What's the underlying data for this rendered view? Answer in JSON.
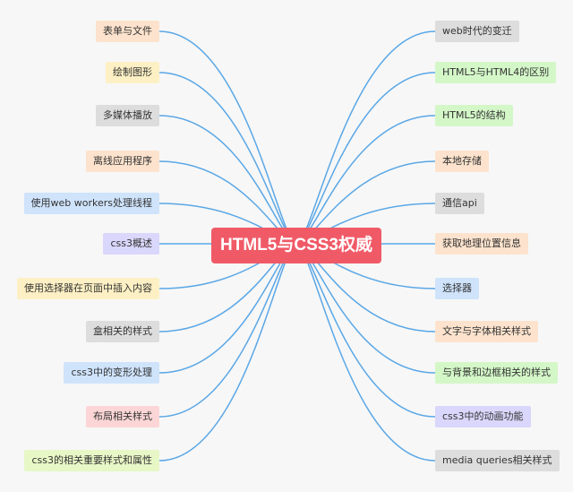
{
  "root": {
    "label": "HTML5与CSS3权威"
  },
  "colors": {
    "line": "#5aa7e6",
    "root_bg": "#f05a67",
    "blue": "#cfe3fb",
    "orange": "#fde3cd",
    "yellow": "#fdf0c4",
    "gray": "#dddddd",
    "purple": "#d9d7fb",
    "red": "#fcd6d6",
    "green": "#d4f7c8",
    "lime": "#e8f7c6"
  },
  "left": [
    {
      "label": "表单与文件",
      "color": "orange"
    },
    {
      "label": "绘制图形",
      "color": "yellow"
    },
    {
      "label": "多媒体播放",
      "color": "gray"
    },
    {
      "label": "离线应用程序",
      "color": "orange"
    },
    {
      "label": "使用web workers处理线程",
      "color": "blue"
    },
    {
      "label": "css3概述",
      "color": "purple"
    },
    {
      "label": "使用选择器在页面中插入内容",
      "color": "yellow"
    },
    {
      "label": "盒相关的样式",
      "color": "gray"
    },
    {
      "label": "css3中的变形处理",
      "color": "blue"
    },
    {
      "label": "布局相关样式",
      "color": "red"
    },
    {
      "label": "css3的相关重要样式和属性",
      "color": "lime"
    }
  ],
  "right": [
    {
      "label": "web时代的变迁",
      "color": "gray"
    },
    {
      "label": "HTML5与HTML4的区别",
      "color": "green"
    },
    {
      "label": "HTML5的结构",
      "color": "green"
    },
    {
      "label": "本地存储",
      "color": "orange"
    },
    {
      "label": "通信api",
      "color": "gray"
    },
    {
      "label": "获取地理位置信息",
      "color": "orange"
    },
    {
      "label": "选择器",
      "color": "blue"
    },
    {
      "label": "文字与字体相关样式",
      "color": "orange"
    },
    {
      "label": "与背景和边框相关的样式",
      "color": "green"
    },
    {
      "label": "css3中的动画功能",
      "color": "purple"
    },
    {
      "label": "media queries相关样式",
      "color": "gray"
    }
  ]
}
